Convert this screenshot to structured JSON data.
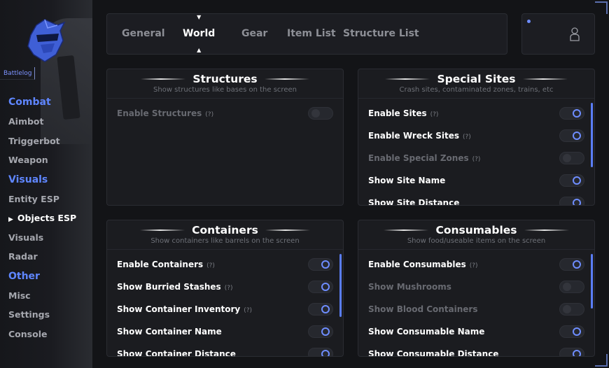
{
  "sidebar": {
    "brand": "Battlelog",
    "sections": [
      {
        "title": "Combat",
        "items": [
          "Aimbot",
          "Triggerbot",
          "Weapon"
        ]
      },
      {
        "title": "Visuals",
        "items": [
          "Entity ESP",
          "Objects ESP",
          "Visuals",
          "Radar"
        ]
      },
      {
        "title": "Other",
        "items": [
          "Misc",
          "Settings",
          "Console"
        ]
      }
    ],
    "active_item": "Objects ESP"
  },
  "tabs": [
    "General",
    "World",
    "Gear",
    "Item List",
    "Structure List"
  ],
  "active_tab": "World",
  "panels": {
    "structures": {
      "title": "Structures",
      "subtitle": "Show structures like bases on the screen",
      "rows": [
        {
          "label": "Enable Structures",
          "help": "(?)",
          "state": "off"
        }
      ]
    },
    "special_sites": {
      "title": "Special Sites",
      "subtitle": "Crash sites, contaminated zones, trains, etc",
      "rows": [
        {
          "label": "Enable Sites",
          "help": "(?)",
          "state": "on"
        },
        {
          "label": "Enable Wreck Sites",
          "help": "(?)",
          "state": "on"
        },
        {
          "label": "Enable Special Zones",
          "help": "(?)",
          "state": "off"
        },
        {
          "label": "Show Site Name",
          "help": "",
          "state": "on"
        },
        {
          "label": "Show Site Distance",
          "help": "",
          "state": "on"
        }
      ]
    },
    "containers": {
      "title": "Containers",
      "subtitle": "Show containers like barrels on the screen",
      "rows": [
        {
          "label": "Enable Containers",
          "help": "(?)",
          "state": "on"
        },
        {
          "label": "Show Burried Stashes",
          "help": "(?)",
          "state": "on"
        },
        {
          "label": "Show Container Inventory",
          "help": "(?)",
          "state": "on"
        },
        {
          "label": "Show Container Name",
          "help": "",
          "state": "on"
        },
        {
          "label": "Show Container Distance",
          "help": "",
          "state": "on"
        }
      ]
    },
    "consumables": {
      "title": "Consumables",
      "subtitle": "Show food/useable items on the screen",
      "rows": [
        {
          "label": "Enable Consumables",
          "help": "(?)",
          "state": "on"
        },
        {
          "label": "Show Mushrooms",
          "help": "",
          "state": "off"
        },
        {
          "label": "Show Blood Containers",
          "help": "",
          "state": "off"
        },
        {
          "label": "Show Consumable Name",
          "help": "",
          "state": "on"
        },
        {
          "label": "Show Consumable Distance",
          "help": "",
          "state": "on"
        }
      ]
    }
  },
  "colors": {
    "accent": "#6e8dff",
    "section": "#5f86ff",
    "scrollbar": "#5a7df5"
  }
}
